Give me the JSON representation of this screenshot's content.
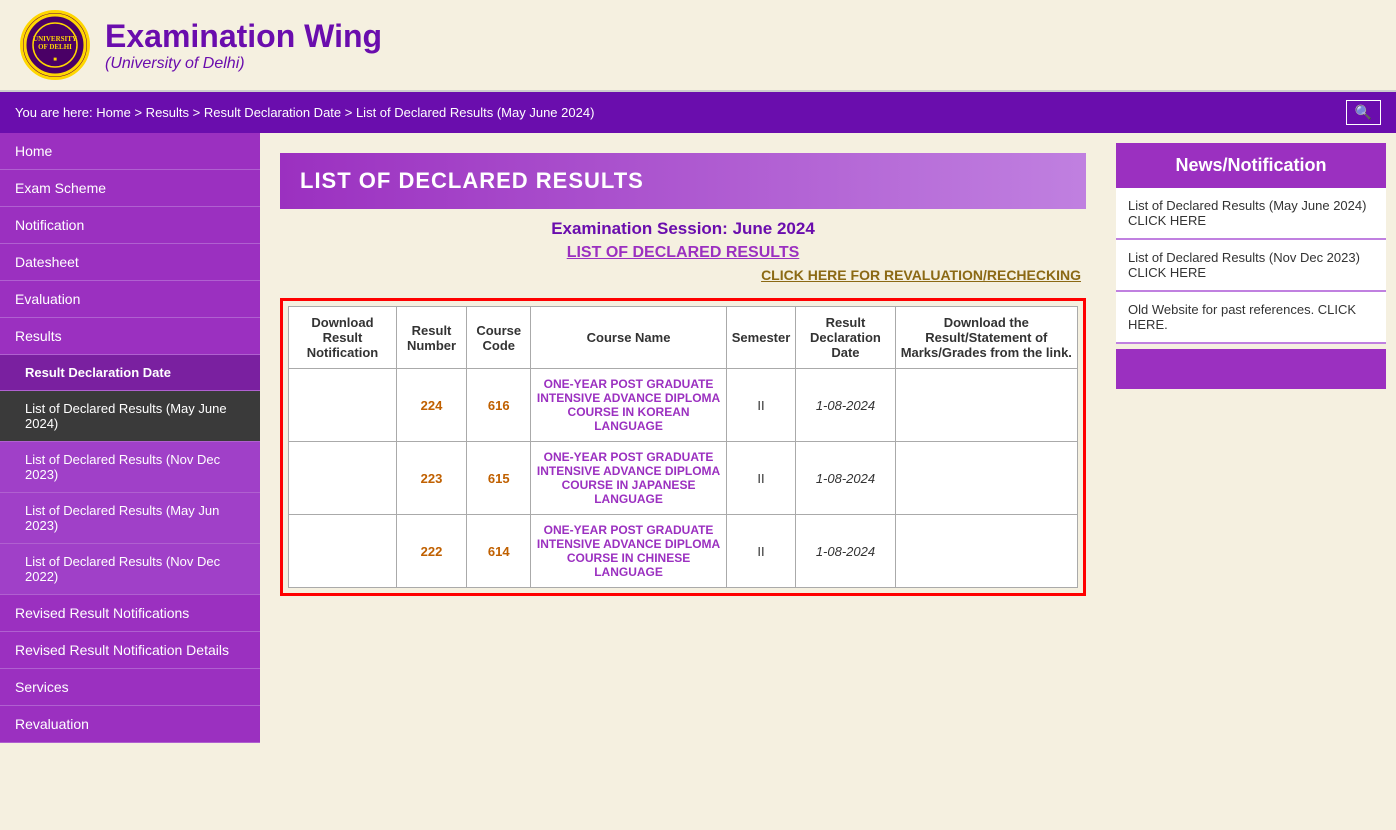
{
  "header": {
    "logo_text": "University\nof Delhi",
    "title": "Examination Wing",
    "subtitle": "(University of Delhi)"
  },
  "breadcrumb": {
    "text": "You are here: Home > Results > Result Declaration Date > List of Declared Results (May June 2024)"
  },
  "sidebar": {
    "items": [
      {
        "id": "home",
        "label": "Home",
        "type": "main",
        "active": false
      },
      {
        "id": "exam-scheme",
        "label": "Exam Scheme",
        "type": "main",
        "active": false
      },
      {
        "id": "notification",
        "label": "Notification",
        "type": "main",
        "active": false
      },
      {
        "id": "datesheet",
        "label": "Datesheet",
        "type": "main",
        "active": false
      },
      {
        "id": "evaluation",
        "label": "Evaluation",
        "type": "main",
        "active": false
      },
      {
        "id": "results",
        "label": "Results",
        "type": "main",
        "active": false
      },
      {
        "id": "result-declaration-date",
        "label": "Result Declaration Date",
        "type": "sub-header",
        "active": false
      },
      {
        "id": "declared-may-june-2024",
        "label": "List of Declared Results (May June 2024)",
        "type": "sub",
        "active": true
      },
      {
        "id": "declared-nov-dec-2023",
        "label": "List of Declared Results (Nov Dec 2023)",
        "type": "sub",
        "active": false
      },
      {
        "id": "declared-may-jun-2023",
        "label": "List of Declared Results (May Jun 2023)",
        "type": "sub",
        "active": false
      },
      {
        "id": "declared-nov-dec-2022",
        "label": "List of Declared Results (Nov Dec 2022)",
        "type": "sub",
        "active": false
      },
      {
        "id": "revised-notifications",
        "label": "Revised Result Notifications",
        "type": "main",
        "active": false
      },
      {
        "id": "revised-notification-details",
        "label": "Revised Result Notification Details",
        "type": "main",
        "active": false
      },
      {
        "id": "services",
        "label": "Services",
        "type": "main",
        "active": false
      },
      {
        "id": "revaluation",
        "label": "Revaluation",
        "type": "main",
        "active": false
      }
    ]
  },
  "content": {
    "page_heading": "LIST OF DECLARED RESULTS",
    "exam_session": "Examination Session: June 2024",
    "declared_results_link": "LIST OF DECLARED RESULTS",
    "revaluation_link": "CLICK HERE FOR REVALUATION/RECHECKING",
    "table": {
      "headers": [
        "Download Result Notification",
        "Result Number",
        "Course Code",
        "Course Name",
        "Semester",
        "Result Declaration Date",
        "Download the Result/Statement of Marks/Grades from the link."
      ],
      "rows": [
        {
          "download": "",
          "result_number": "224",
          "course_code": "616",
          "course_name": "ONE-YEAR POST GRADUATE INTENSIVE ADVANCE DIPLOMA COURSE IN KOREAN LANGUAGE",
          "semester": "II",
          "declaration_date": "1-08-2024",
          "download_link": ""
        },
        {
          "download": "",
          "result_number": "223",
          "course_code": "615",
          "course_name": "ONE-YEAR POST GRADUATE INTENSIVE ADVANCE DIPLOMA COURSE IN JAPANESE LANGUAGE",
          "semester": "II",
          "declaration_date": "1-08-2024",
          "download_link": ""
        },
        {
          "download": "",
          "result_number": "222",
          "course_code": "614",
          "course_name": "ONE-YEAR POST GRADUATE INTENSIVE ADVANCE DIPLOMA COURSE IN CHINESE LANGUAGE",
          "semester": "II",
          "declaration_date": "1-08-2024",
          "download_link": ""
        }
      ]
    }
  },
  "news": {
    "header": "News/Notification",
    "items": [
      {
        "label": "List of Declared Results (May June 2024) CLICK HERE"
      },
      {
        "label": "List of Declared Results (Nov Dec 2023) CLICK HERE"
      },
      {
        "label": "Old Website for past references. CLICK HERE."
      }
    ]
  }
}
